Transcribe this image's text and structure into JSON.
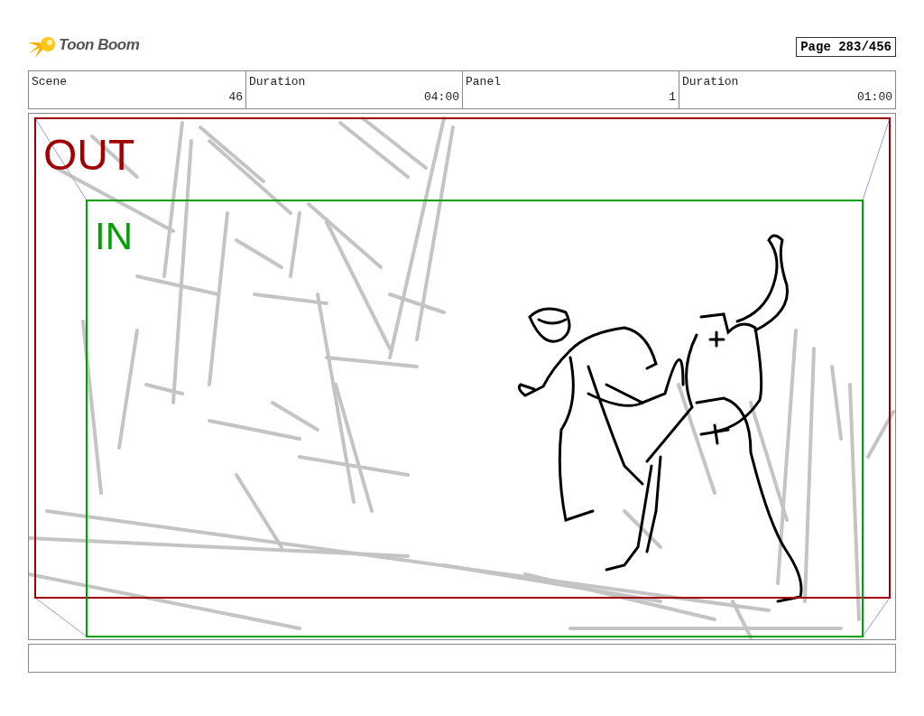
{
  "logo": {
    "text": "Toon Boom"
  },
  "page_number": "Page 283/456",
  "info_table": {
    "columns": [
      "Scene",
      "Duration",
      "Panel",
      "Duration"
    ],
    "rows": [
      [
        "46",
        "04:00",
        "1",
        "01:00"
      ]
    ]
  },
  "panel": {
    "frames": [
      {
        "label": "OUT",
        "color": "#a00000"
      },
      {
        "label": "IN",
        "color": "#00a000"
      }
    ]
  }
}
